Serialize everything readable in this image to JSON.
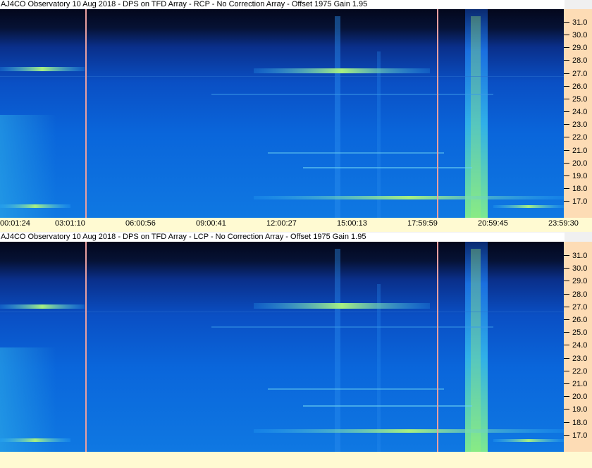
{
  "panels": [
    {
      "title": "AJ4CO Observatory 10 Aug 2018 - DPS on TFD Array   - RCP   -  No Correction Array   -  Offset 1975  Gain 1.95",
      "polarization": "RCP"
    },
    {
      "title": "AJ4CO Observatory 10 Aug 2018 - DPS on TFD Array   - LCP   -  No Correction Array   -  Offset 1975  Gain 1.95",
      "polarization": "LCP"
    }
  ],
  "freq_labels": [
    "31.0",
    "30.0",
    "29.0",
    "28.0",
    "27.0",
    "26.0",
    "25.0",
    "24.0",
    "23.0",
    "22.0",
    "21.0",
    "20.0",
    "19.0",
    "18.0",
    "17.0"
  ],
  "time_labels": [
    "00:01:24",
    "03:01:10",
    "06:00:56",
    "09:00:41",
    "12:00:27",
    "15:00:13",
    "17:59:59",
    "20:59:45",
    "23:59:30"
  ],
  "colors": {
    "background_blue": "#0a5fd8",
    "dark_top": "#050a24",
    "emission_green": "#8cf070",
    "freq_axis_bg": "#fddcb5",
    "time_axis_bg": "#fffad2",
    "cursor": "#e9a0a0"
  }
}
